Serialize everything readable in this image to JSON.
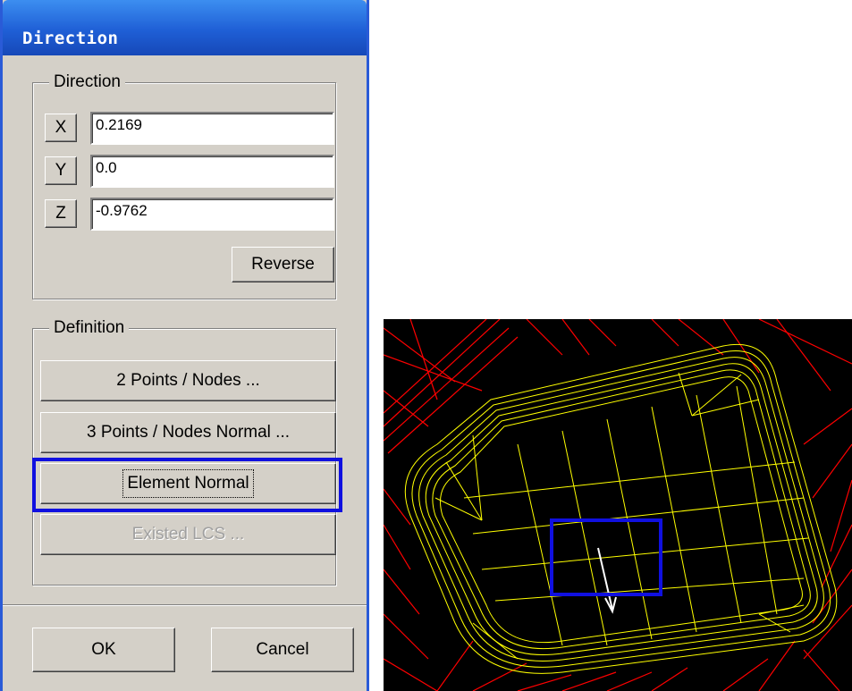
{
  "dialog": {
    "title": "Direction",
    "direction_group": {
      "label": "Direction",
      "fields": [
        {
          "button": "X",
          "value": "0.2169"
        },
        {
          "button": "Y",
          "value": "0.0"
        },
        {
          "button": "Z",
          "value": "-0.9762"
        }
      ],
      "reverse_label": "Reverse"
    },
    "definition_group": {
      "label": "Definition",
      "buttons": [
        {
          "label": "2 Points / Nodes ...",
          "enabled": true
        },
        {
          "label": "3 Points / Nodes Normal ...",
          "enabled": true
        },
        {
          "label": "Element Normal",
          "enabled": true,
          "highlighted": true
        },
        {
          "label": "Existed LCS ...",
          "enabled": false
        }
      ]
    },
    "ok_label": "OK",
    "cancel_label": "Cancel"
  },
  "viewport": {
    "highlight_color": "#1010e0",
    "mesh_color_part": "#ffff00",
    "mesh_color_surround": "#ff0000",
    "arrow_color": "#ffffff"
  },
  "colors": {
    "titlebar": "#1f5fd6",
    "dialog_bg": "#d4d0c8",
    "highlight": "#1010e0"
  }
}
